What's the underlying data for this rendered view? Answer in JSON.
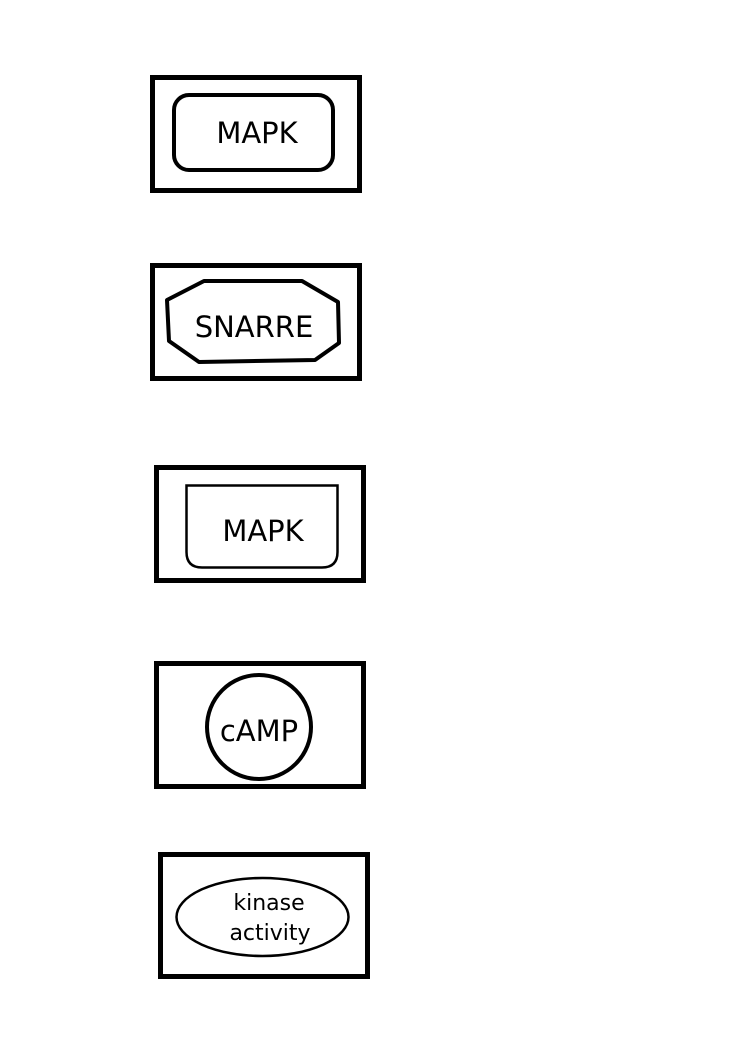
{
  "legend": {
    "items": [
      {
        "kind": "macromolecule",
        "label": "MAPK"
      },
      {
        "kind": "complex",
        "label": "SNARRE"
      },
      {
        "kind": "nucleic-acid-feature",
        "label": "MAPK"
      },
      {
        "kind": "simple-chemical",
        "label": "cAMP"
      },
      {
        "kind": "phenotype",
        "label_lines": [
          "kinase",
          "activity"
        ]
      }
    ]
  },
  "colors": {
    "stroke": "#000000",
    "background": "#ffffff"
  }
}
